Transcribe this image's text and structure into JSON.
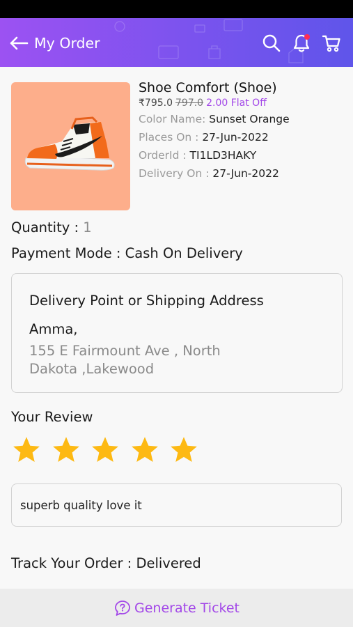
{
  "header": {
    "title": "My Order",
    "back_icon": "arrow-left-icon",
    "search_icon": "search-icon",
    "notification_icon": "bell-icon",
    "cart_icon": "cart-icon",
    "gradient_start": "#9c52f2",
    "gradient_end": "#5f55ea"
  },
  "product": {
    "image_icon": "sneaker-icon",
    "image_bg": "#fdae8b",
    "title": "Shoe Comfort (Shoe)",
    "price": "₹795.0",
    "original_price": "797.0",
    "discount": "2.00 Flat Off",
    "details": [
      {
        "label": "Color Name: ",
        "value": "Sunset Orange"
      },
      {
        "label": "Places On : ",
        "value": "27-Jun-2022"
      },
      {
        "label": "OrderId : ",
        "value": "TI1LD3HAKY"
      },
      {
        "label": "Delivery On : ",
        "value": "27-Jun-2022"
      }
    ]
  },
  "order": {
    "quantity_label": "Quantity : ",
    "quantity_value": "1",
    "payment_label": "Payment Mode  : ",
    "payment_value": "Cash On Delivery"
  },
  "address": {
    "heading": "Delivery Point or Shipping Address",
    "name": "Amma,",
    "line": "155 E Fairmount Ave , North Dakota ,Lakewood"
  },
  "review": {
    "heading": "Your Review",
    "rating": 5,
    "max_rating": 5,
    "star_color": "#fdb913",
    "text": "superb quality love it"
  },
  "tracking": {
    "label": "Track Your Order : ",
    "status": "Delivered"
  },
  "footer": {
    "ticket_icon": "chat-question-icon",
    "ticket_label": "Generate Ticket",
    "accent": "#a246e8"
  }
}
